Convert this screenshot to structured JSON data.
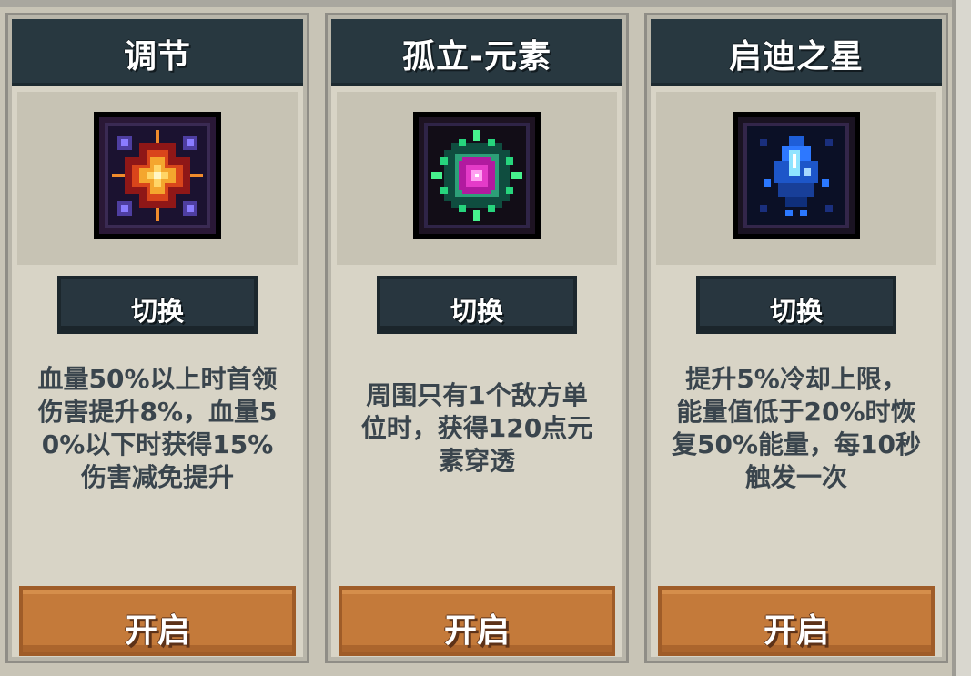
{
  "cards": [
    {
      "title": "调节",
      "switch_label": "切换",
      "description_lines": [
        "血量50%以上时首领",
        "伤害提升8%，血量5",
        "0%以下时获得15%",
        "伤害减免提升"
      ],
      "open_label": "开启",
      "icon": "radiant-star-rune-icon",
      "accent": "#f2b74a"
    },
    {
      "title": "孤立-元素",
      "switch_label": "切换",
      "description_lines": [
        "周围只有1个敌方单",
        "位时，获得120点元",
        "素穿透"
      ],
      "open_label": "开启",
      "icon": "emerald-pink-rune-icon",
      "accent": "#e05acb"
    },
    {
      "title": "启迪之星",
      "switch_label": "切换",
      "description_lines": [
        "提升5%冷却上限，",
        "能量值低于20%时恢",
        "复50%能量，每10秒",
        "触发一次"
      ],
      "open_label": "开启",
      "icon": "blue-crystal-rune-icon",
      "accent": "#4d8df7"
    }
  ]
}
